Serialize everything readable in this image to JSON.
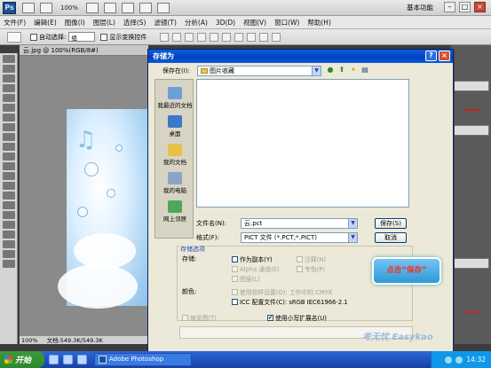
{
  "appbar": {
    "logo": "Ps",
    "zoom": "100%",
    "workspace": "基本功能",
    "icons": [
      "document-icon",
      "frame-icon",
      "hand-icon",
      "zoom-tool-icon",
      "rotate-icon",
      "grid-icon",
      "arrange-icon"
    ]
  },
  "menubar": {
    "items": [
      "文件(F)",
      "编辑(E)",
      "图像(I)",
      "图层(L)",
      "选择(S)",
      "滤镜(T)",
      "分析(A)",
      "3D(D)",
      "视图(V)",
      "窗口(W)",
      "帮助(H)"
    ]
  },
  "optionsbar": {
    "auto_select": "自动选择:",
    "auto_select_value": "组",
    "show_transform": "显示变换控件"
  },
  "document": {
    "tab_title": "云.jpg @ 100%(RGB/8#)",
    "zoom": "100%",
    "doc_size": "文档:549.3K/549.3K"
  },
  "dialog": {
    "title": "存储为",
    "help_label": "?",
    "close_label": "×",
    "save_in_label": "保存在(I):",
    "save_in_value": "图片收藏",
    "places": [
      {
        "label": "我最近的文档",
        "icon": "recent-documents-icon",
        "color": "#6a9fd8"
      },
      {
        "label": "桌面",
        "icon": "desktop-icon",
        "color": "#3a78c8"
      },
      {
        "label": "我的文档",
        "icon": "my-documents-icon",
        "color": "#e7c24a"
      },
      {
        "label": "我的电脑",
        "icon": "my-computer-icon",
        "color": "#8aa4c8"
      },
      {
        "label": "网上邻居",
        "icon": "network-icon",
        "color": "#4ea85a"
      }
    ],
    "filename_label": "文件名(N):",
    "filename_value": "云.pct",
    "format_label": "格式(F):",
    "format_value": "PICT 文件 (*.PCT;*.PICT)",
    "save_button": "保存(S)",
    "cancel_button": "取消",
    "options_title": "存储选项",
    "save_group_label": "存储:",
    "as_copy": "作为副本(Y)",
    "annotations": "注释(N)",
    "alpha_channels": "Alpha 通道(E)",
    "spot_colors": "专色(P)",
    "layers": "图层(L)",
    "color_label": "颜色:",
    "use_proof": "使用校样设置(O): 工作中的 CMYK",
    "icc_profile": "ICC 配置文件(C): sRGB IEC61966-2.1",
    "thumbnail": "缩览图(T)",
    "lowercase_ext": "使用小写扩展名(U)"
  },
  "callout": {
    "text": "点击“保存”"
  },
  "taskbar": {
    "start": "开始",
    "task_label": "Adobe Photoshop",
    "clock": "14:32"
  },
  "watermark": "考无忧 Easykao"
}
